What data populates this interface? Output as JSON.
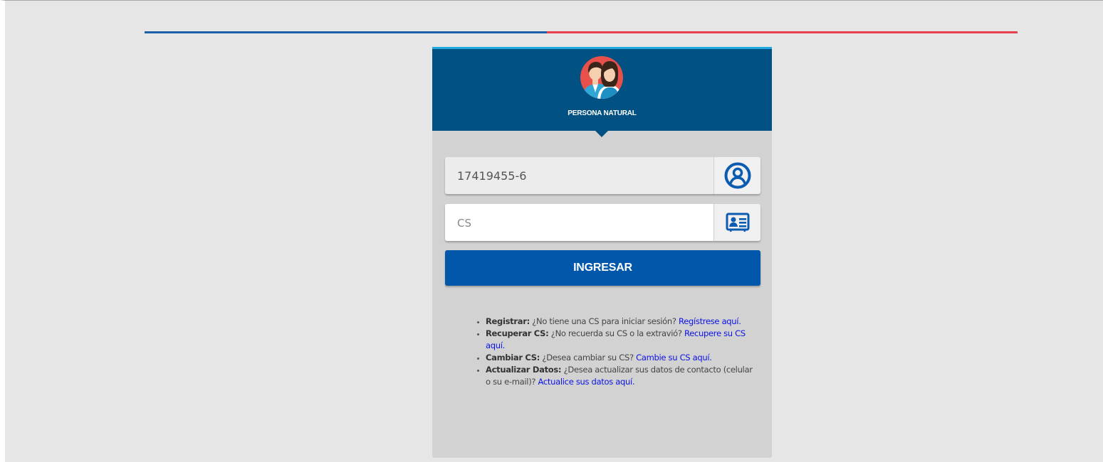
{
  "colors": {
    "page_bg": "#e6e6e6",
    "line_blue": "#1b5fa8",
    "line_red": "#e8414d",
    "header_bg": "#025183",
    "header_top_accent": "#22a8e0",
    "button_bg": "#0158ab",
    "link": "#0b12e6",
    "icon_blue": "#0b5cb0"
  },
  "header": {
    "avatar_icon": "people-couple-icon",
    "title": "PERSONA NATURAL"
  },
  "form": {
    "rut_value": "17419455-6",
    "rut_icon": "user-circle-icon",
    "cs_placeholder": "CS",
    "cs_icon": "id-card-icon",
    "submit_label": "INGRESAR"
  },
  "help": [
    {
      "label": "Registrar:",
      "text": " ¿No tiene una CS para iniciar sesión? ",
      "link": "Regístrese aquí."
    },
    {
      "label": "Recuperar CS:",
      "text": " ¿No recuerda su CS o la extravió? ",
      "link": "Recupere su CS aquí."
    },
    {
      "label": "Cambiar CS:",
      "text": " ¿Desea cambiar su CS? ",
      "link": "Cambie su CS aquí."
    },
    {
      "label": "Actualizar Datos:",
      "text": " ¿Desea actualizar sus datos de contacto (celular o su e-mail)? ",
      "link": "Actualice sus datos aquí."
    }
  ]
}
